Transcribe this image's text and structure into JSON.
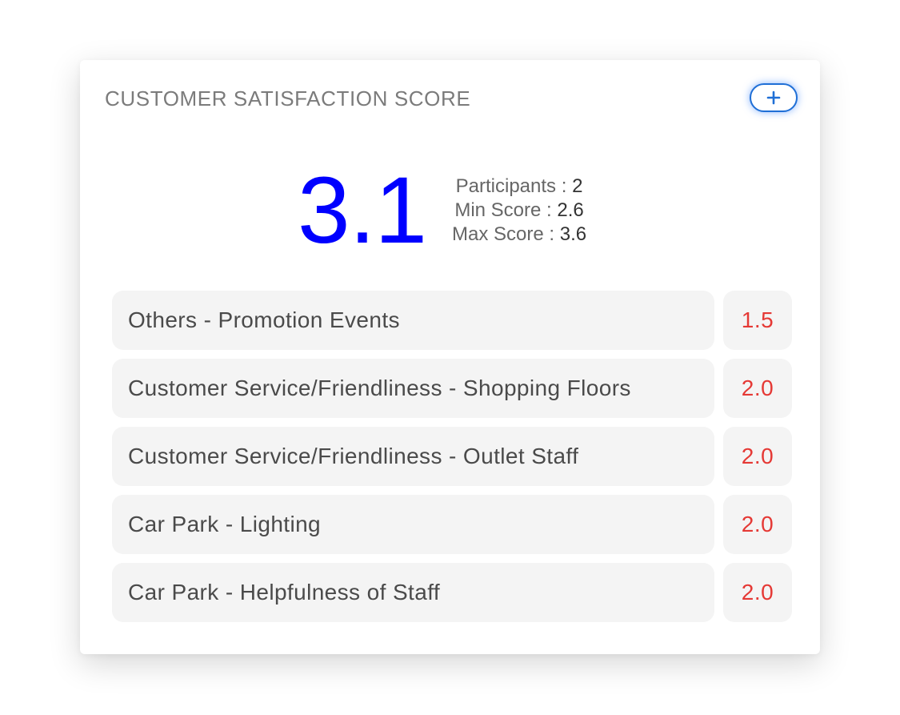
{
  "card": {
    "title": "CUSTOMER SATISFACTION SCORE",
    "add_button_icon": "plus-icon"
  },
  "score": {
    "value": "3.1",
    "participants_label": "Participants :",
    "participants_value": "2",
    "min_label": "Min Score :",
    "min_value": "2.6",
    "max_label": "Max Score :",
    "max_value": "3.6"
  },
  "categories": [
    {
      "label": "Others - Promotion Events",
      "score": "1.5"
    },
    {
      "label": "Customer Service/Friendliness - Shopping Floors",
      "score": "2.0"
    },
    {
      "label": "Customer Service/Friendliness - Outlet Staff",
      "score": "2.0"
    },
    {
      "label": "Car Park - Lighting",
      "score": "2.0"
    },
    {
      "label": "Car Park - Helpfulness of Staff",
      "score": "2.0"
    }
  ],
  "colors": {
    "score_blue": "#0000ff",
    "low_score_red": "#e53935",
    "accent_blue": "#1f6fd6"
  }
}
